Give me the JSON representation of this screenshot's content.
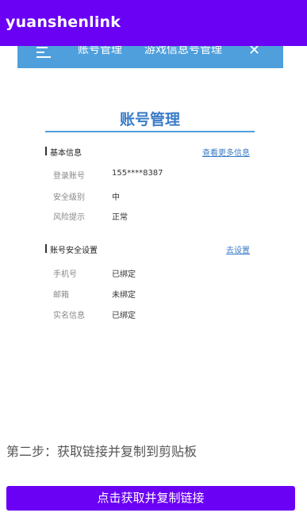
{
  "app": {
    "title": "yuanshenlink"
  },
  "webnav": {
    "tabs": [
      "账号管理",
      "游戏信息号管理"
    ]
  },
  "card": {
    "title": "账号管理",
    "basic": {
      "heading": "基本信息",
      "link": "查看更多信息",
      "rows": [
        {
          "label": "登录账号",
          "value": "155****8387"
        },
        {
          "label": "安全级别",
          "value": "中"
        },
        {
          "label": "风险提示",
          "value": "正常"
        }
      ]
    },
    "security": {
      "heading": "账号安全设置",
      "link": "去设置",
      "rows": [
        {
          "label": "手机号",
          "value": "已绑定"
        },
        {
          "label": "邮箱",
          "value": "未绑定"
        },
        {
          "label": "实名信息",
          "value": "已绑定"
        }
      ]
    }
  },
  "step": {
    "text": "第二步：获取链接并复制到剪贴板"
  },
  "action": {
    "copy_label": "点击获取并复制链接"
  }
}
